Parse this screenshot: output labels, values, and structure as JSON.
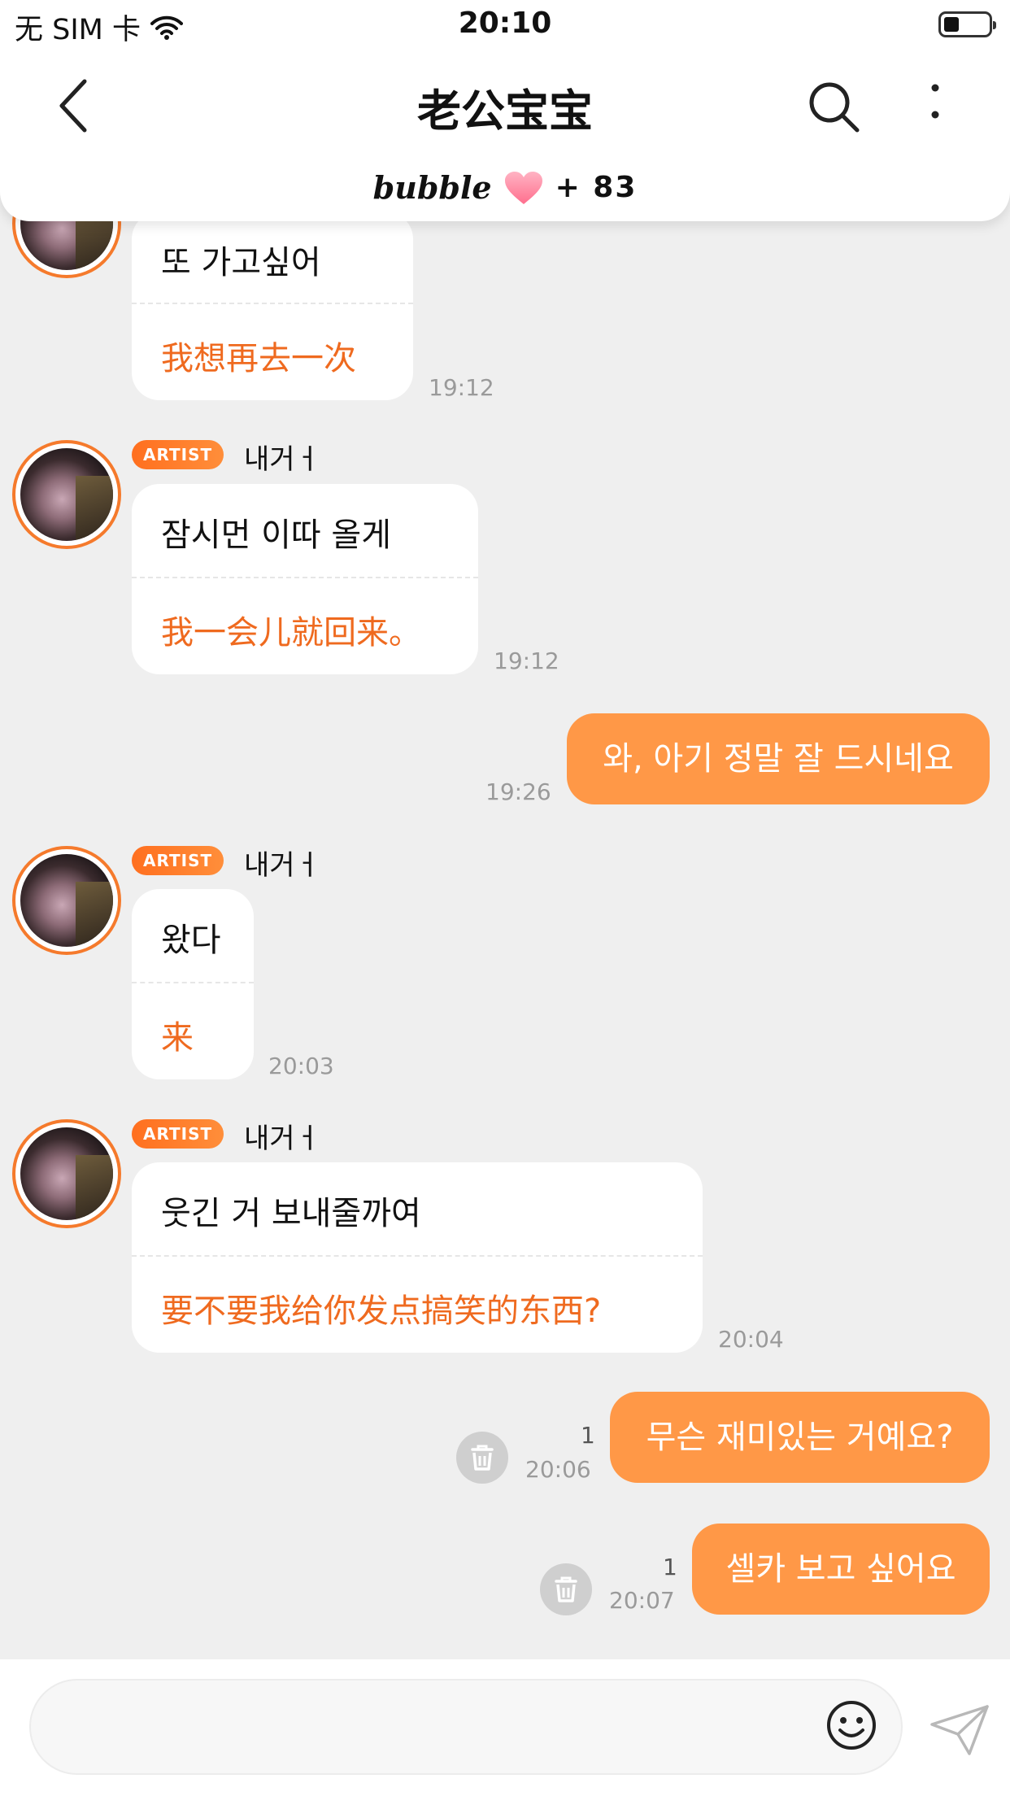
{
  "status_bar": {
    "carrier": "无 SIM 卡",
    "time": "20:10"
  },
  "header": {
    "title": "老公宝宝",
    "bubble_label": "bubble",
    "bubble_count": "+ 83"
  },
  "messages": [
    {
      "type": "received",
      "ko": "또 가고싶어",
      "zh": "我想再去一次",
      "time": "19:12"
    },
    {
      "type": "received",
      "badge": "ARTIST",
      "sender": "내거ㅓ",
      "ko": "잠시먼 이따 올게",
      "zh": "我一会儿就回来。",
      "time": "19:12"
    },
    {
      "type": "sent",
      "text": "와, 아기 정말 잘 드시네요",
      "time": "19:26"
    },
    {
      "type": "received",
      "badge": "ARTIST",
      "sender": "내거ㅓ",
      "ko": "왔다",
      "zh": "来",
      "time": "20:03"
    },
    {
      "type": "received",
      "badge": "ARTIST",
      "sender": "내거ㅓ",
      "ko": "웃긴 거 보내줄까여",
      "zh": "要不要我给你发点搞笑的东西?",
      "time": "20:04"
    },
    {
      "type": "sent",
      "text": "무슨 재미있는 거예요?",
      "time": "20:06",
      "unread": "1"
    },
    {
      "type": "sent",
      "text": "셀카 보고 싶어요",
      "time": "20:07",
      "unread": "1"
    }
  ],
  "colors": {
    "accent": "#ff9847",
    "translation": "#ef6a1f",
    "background": "#efefef"
  },
  "icons": [
    "back-chevron-icon",
    "search-icon",
    "more-vertical-icon",
    "heart-icon",
    "trash-icon",
    "emoji-icon",
    "send-icon"
  ]
}
